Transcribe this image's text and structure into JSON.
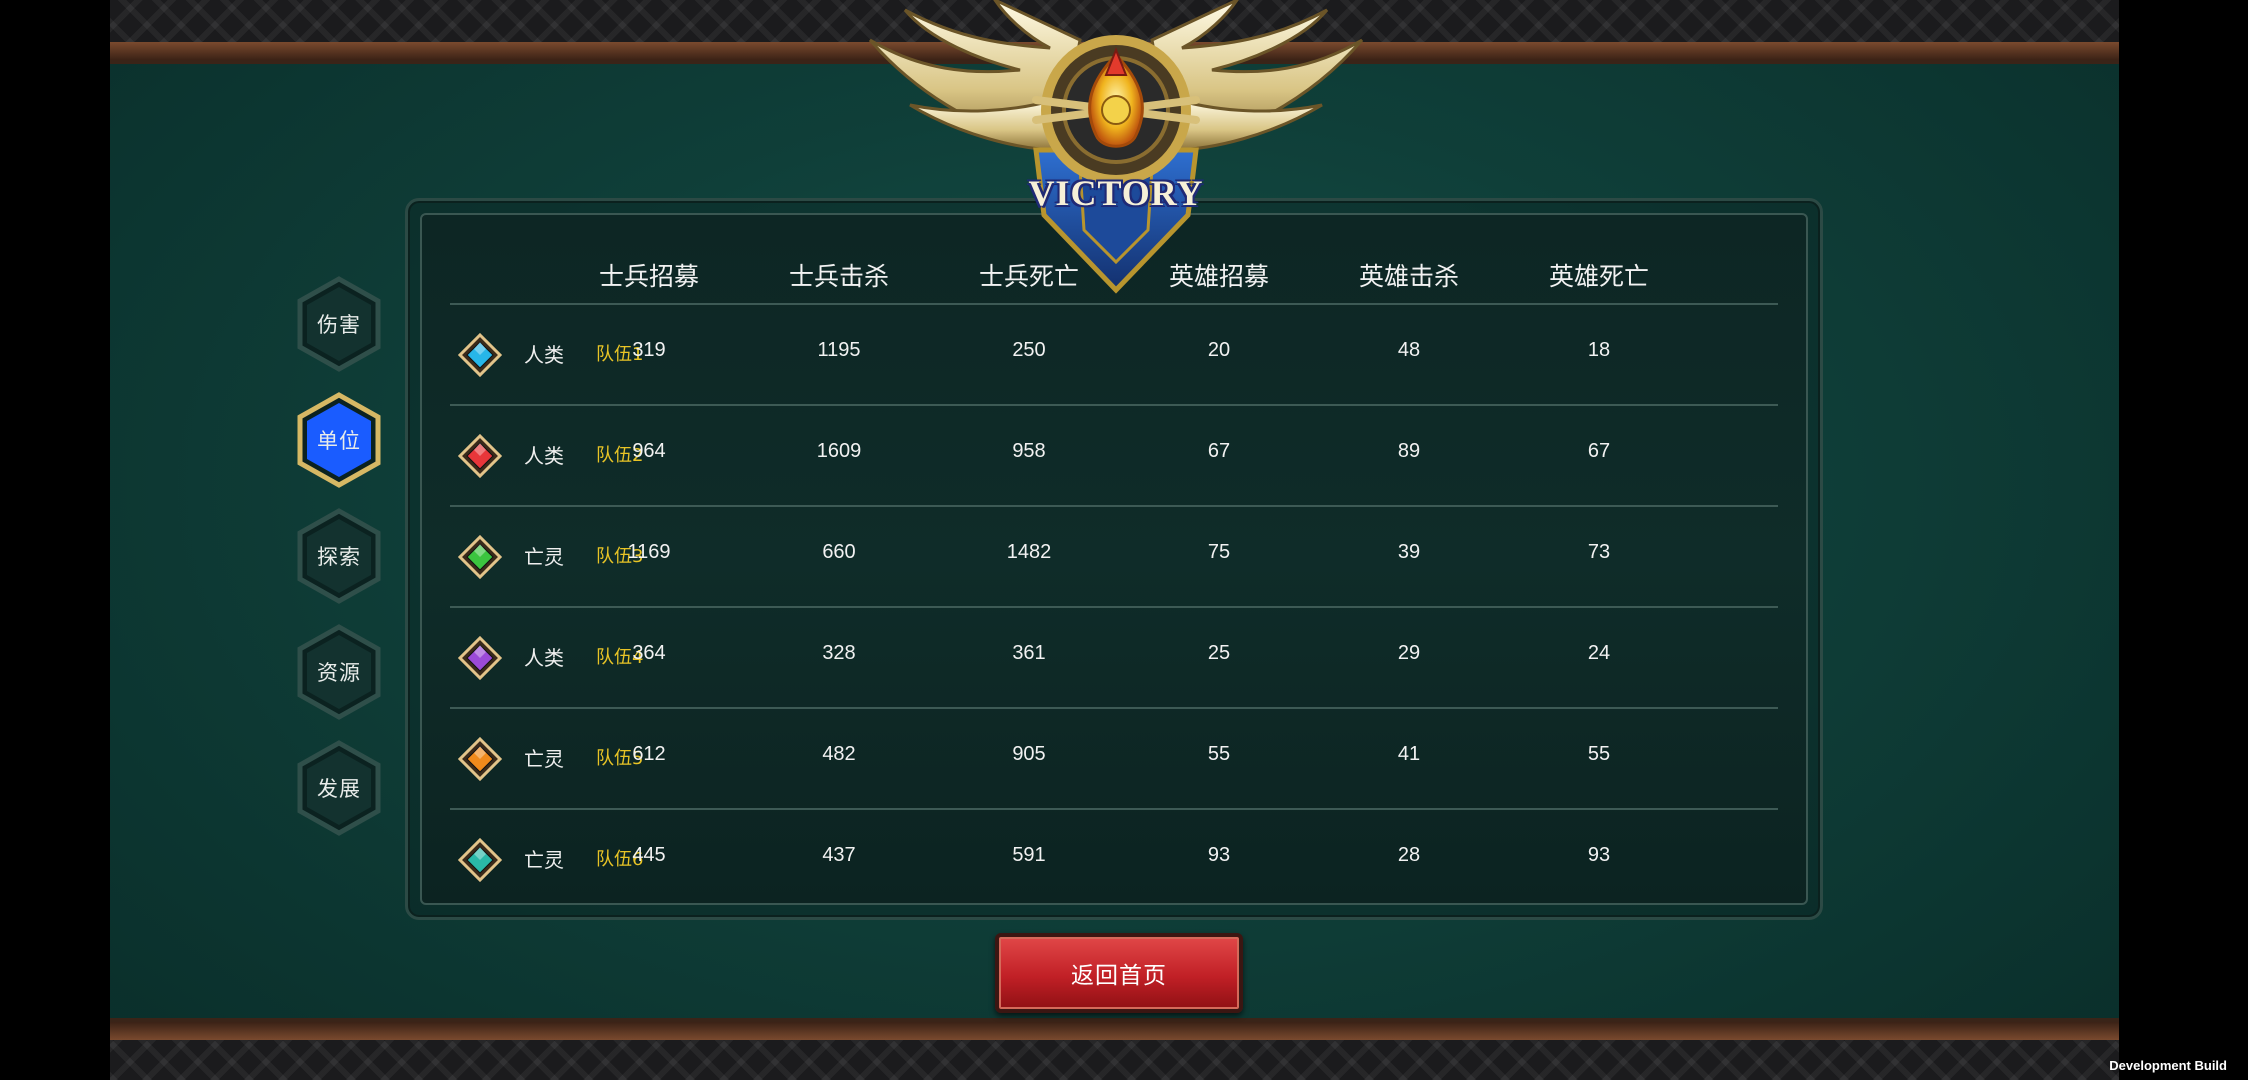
{
  "result_title": "VICTORY",
  "nav": [
    {
      "label": "伤害",
      "active": false
    },
    {
      "label": "单位",
      "active": true
    },
    {
      "label": "探索",
      "active": false
    },
    {
      "label": "资源",
      "active": false
    },
    {
      "label": "发展",
      "active": false
    }
  ],
  "table": {
    "columns": [
      "士兵招募",
      "士兵击杀",
      "士兵死亡",
      "英雄招募",
      "英雄击杀",
      "英雄死亡"
    ],
    "rows": [
      {
        "gem_color": "#27b6e8",
        "race": "人类",
        "team": "队伍1",
        "values": [
          "319",
          "1195",
          "250",
          "20",
          "48",
          "18"
        ]
      },
      {
        "gem_color": "#e8363a",
        "race": "人类",
        "team": "队伍2",
        "values": [
          "964",
          "1609",
          "958",
          "67",
          "89",
          "67"
        ]
      },
      {
        "gem_color": "#3cc43f",
        "race": "亡灵",
        "team": "队伍3",
        "values": [
          "1169",
          "660",
          "1482",
          "75",
          "39",
          "73"
        ]
      },
      {
        "gem_color": "#9b4ad8",
        "race": "人类",
        "team": "队伍4",
        "values": [
          "364",
          "328",
          "361",
          "25",
          "29",
          "24"
        ]
      },
      {
        "gem_color": "#f08a1c",
        "race": "亡灵",
        "team": "队伍5",
        "values": [
          "612",
          "482",
          "905",
          "55",
          "41",
          "55"
        ]
      },
      {
        "gem_color": "#2ab8a8",
        "race": "亡灵",
        "team": "队伍6",
        "values": [
          "445",
          "437",
          "591",
          "93",
          "28",
          "93"
        ]
      }
    ]
  },
  "return_button": "返回首页",
  "dev_build": "Development Build",
  "colors": {
    "team_label": "#e8c426",
    "active_nav": "#1a5cff",
    "return_button": "#c12026"
  }
}
